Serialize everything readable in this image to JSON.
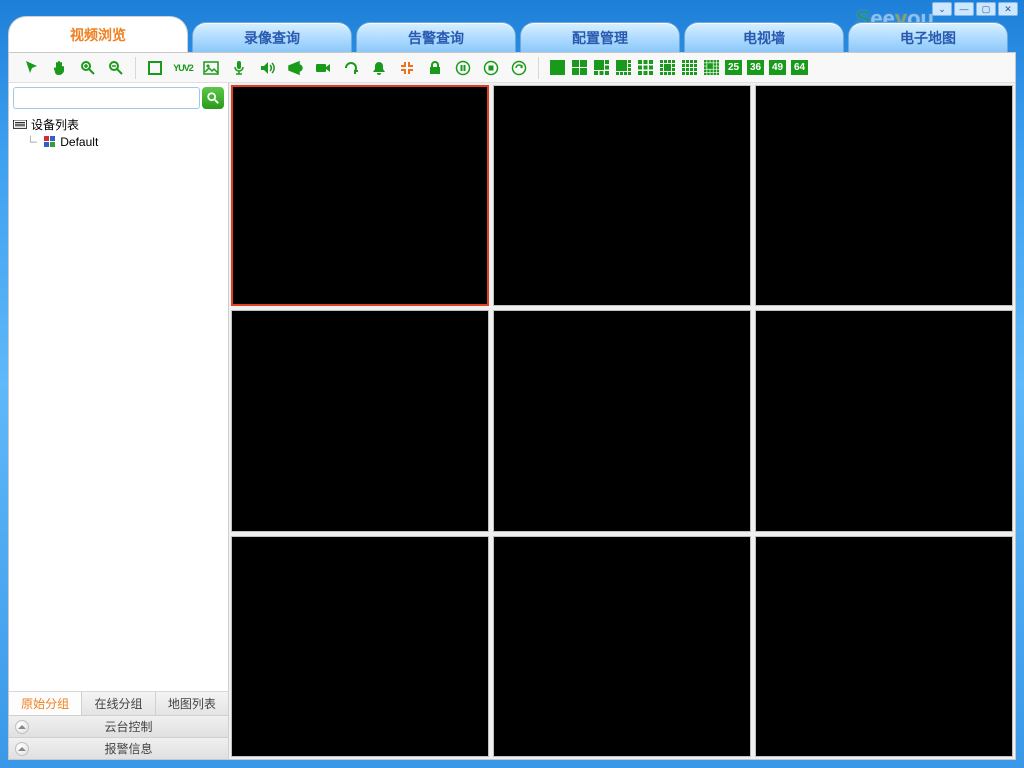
{
  "brand": "Seeyou",
  "window_controls": {
    "opts": "⌄",
    "min": "—",
    "max": "▢",
    "close": "✕"
  },
  "tabs": [
    {
      "label": "视频浏览",
      "active": true
    },
    {
      "label": "录像查询"
    },
    {
      "label": "告警查询"
    },
    {
      "label": "配置管理"
    },
    {
      "label": "电视墙"
    },
    {
      "label": "电子地图"
    }
  ],
  "toolbar": {
    "group1": [
      "pointer",
      "hand",
      "zoom-in",
      "zoom-out"
    ],
    "group2": [
      "frame",
      "yuv2",
      "image",
      "mic",
      "audio",
      "horn",
      "record",
      "refresh",
      "alarm",
      "fullscreen-exit",
      "lock",
      "pause",
      "stop",
      "sequence"
    ],
    "layouts": [
      1,
      4,
      6,
      8,
      9,
      13,
      16,
      20
    ],
    "layout_numbers": [
      "25",
      "36",
      "49",
      "64"
    ]
  },
  "search": {
    "placeholder": ""
  },
  "tree": {
    "root": "设备列表",
    "children": [
      "Default"
    ]
  },
  "side_tabs": [
    {
      "label": "原始分组",
      "active": true
    },
    {
      "label": "在线分组"
    },
    {
      "label": "地图列表"
    }
  ],
  "side_panels": [
    "云台控制",
    "报警信息"
  ],
  "grid": {
    "rows": 3,
    "cols": 3,
    "selected": 0
  }
}
